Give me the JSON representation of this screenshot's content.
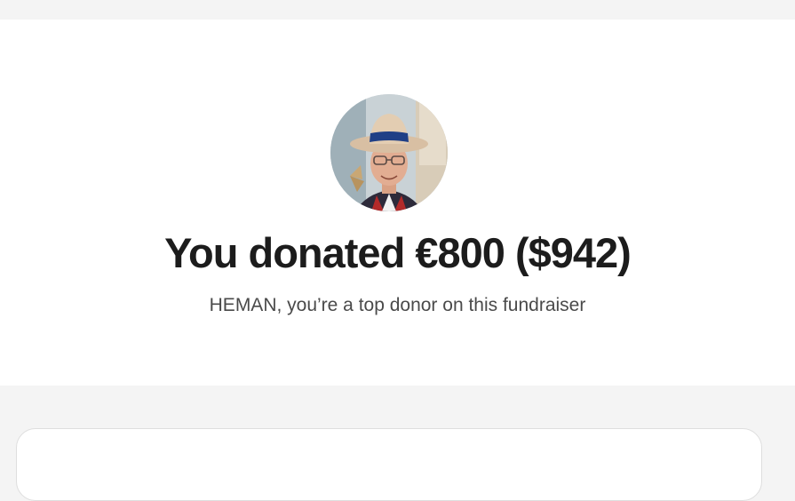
{
  "donation": {
    "avatar_alt": "Fundraiser organizer photo",
    "headline": "You donated €800 ($942)",
    "subline": "HEMAN, you’re a top donor on this fundraiser"
  },
  "colors": {
    "page_background": "#f4f4f4",
    "panel_background": "#ffffff",
    "headline_text": "#1c1c1c",
    "subline_text": "#4a4a4a"
  }
}
